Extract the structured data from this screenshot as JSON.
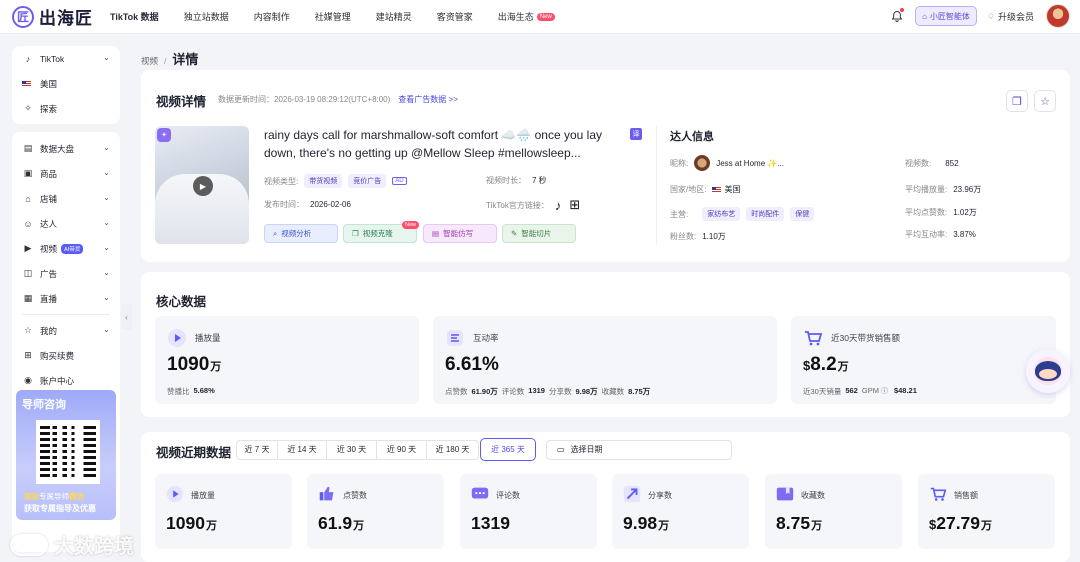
{
  "brand": {
    "logo_char": "匠",
    "name": "出海匠"
  },
  "nav": [
    {
      "label": "TikTok 数据",
      "active": true
    },
    {
      "label": "独立站数据"
    },
    {
      "label": "内容制作"
    },
    {
      "label": "社媒管理"
    },
    {
      "label": "建站精灵"
    },
    {
      "label": "客资管家"
    },
    {
      "label": "出海生态",
      "badge": "New"
    }
  ],
  "top_right": {
    "ai_label": "小匠智能体",
    "upgrade_label": "升级会员"
  },
  "sidebar_top": [
    {
      "label": "TikTok"
    },
    {
      "label": "美国"
    },
    {
      "label": "探索"
    }
  ],
  "sidebar_menu": [
    {
      "label": "数据大盘"
    },
    {
      "label": "商品"
    },
    {
      "label": "店铺"
    },
    {
      "label": "达人"
    },
    {
      "label": "视频",
      "tag": "AI带货"
    },
    {
      "label": "广告"
    },
    {
      "label": "直播"
    }
  ],
  "sidebar_bottom": [
    {
      "label": "我的"
    },
    {
      "label": "购买续费"
    },
    {
      "label": "账户中心"
    }
  ],
  "promo": {
    "title": "导师咨询",
    "line1_prefix": "添加",
    "line1_mid": "专属导师",
    "line1_hl": "微信",
    "line2": "获取专属指导及优惠"
  },
  "breadcrumb": {
    "parent": "视频",
    "sep": "/",
    "current": "详情"
  },
  "video": {
    "section_title": "视频详情",
    "update_label": "数据更新时间：",
    "update_time": "2026-03-19 08:29:12(UTC+8:00)",
    "ad_link": "查看广告数据 >>",
    "title": "rainy days call for marshmallow-soft comfort ☁️🌧️ once you lay down, there's no getting up @Mellow Sleep #mellowsleep...",
    "type_label": "视频类型:",
    "type_tags": [
      "带货视频",
      "竞价广告"
    ],
    "ad_badge": "AD",
    "duration_label": "视频时长：",
    "duration": "7 秒",
    "publish_label": "发布时间：",
    "publish_date": "2026-02-06",
    "link_label": "TikTok官方链接：",
    "tools": [
      {
        "label": "视频分析"
      },
      {
        "label": "视频克隆",
        "badge": "New"
      },
      {
        "label": "智能仿写"
      },
      {
        "label": "智能切片"
      }
    ]
  },
  "influencer": {
    "title": "达人信息",
    "nick_label": "昵称:",
    "nick": "Jess at Home ✨...",
    "region_label": "国家/地区:",
    "region": "美国",
    "category_label": "主营:",
    "categories": [
      "家纺布艺",
      "时尚配件",
      "保健"
    ],
    "fans_label": "粉丝数:",
    "fans": "1.10万",
    "videos_label": "视频数:",
    "videos": "852",
    "avg_play_label": "平均播放量:",
    "avg_play": "23.96万",
    "avg_like_label": "平均点赞数:",
    "avg_like": "1.02万",
    "avg_inter_label": "平均互动率:",
    "avg_inter": "3.87%"
  },
  "core": {
    "title": "核心数据",
    "play": {
      "label": "播放量",
      "value": "1090",
      "unit": "万",
      "sub_label": "赞播比",
      "sub_value": "5.68%"
    },
    "interaction": {
      "label": "互动率",
      "value": "6.61%",
      "likes_label": "点赞数",
      "likes": "61.90万",
      "comments_label": "评论数",
      "comments": "1319",
      "shares_label": "分享数",
      "shares": "9.98万",
      "fav_label": "收藏数",
      "fav": "8.75万"
    },
    "sales": {
      "label": "近30天带货销售额",
      "currency": "$",
      "value": "8.2",
      "unit": "万",
      "qty_label": "近30天销量",
      "qty": "562",
      "gpm_label": "GPM",
      "gpm": "$48.21"
    }
  },
  "recent": {
    "title": "视频近期数据",
    "ranges": [
      "近 7 天",
      "近 14 天",
      "近 30 天",
      "近 90 天",
      "近 180 天",
      "近 365 天"
    ],
    "active_range": "近 365 天",
    "date_placeholder": "选择日期",
    "metrics": [
      {
        "label": "播放量",
        "value": "1090",
        "unit": "万"
      },
      {
        "label": "点赞数",
        "value": "61.9",
        "unit": "万"
      },
      {
        "label": "评论数",
        "value": "1319",
        "unit": ""
      },
      {
        "label": "分享数",
        "value": "9.98",
        "unit": "万"
      },
      {
        "label": "收藏数",
        "value": "8.75",
        "unit": "万"
      },
      {
        "label": "销售额",
        "currency": "$",
        "value": "27.79",
        "unit": "万"
      }
    ]
  },
  "watermark": "大数跨境",
  "colors": {
    "accent": "#5b5bf7",
    "brand": "#6d5cf0"
  }
}
